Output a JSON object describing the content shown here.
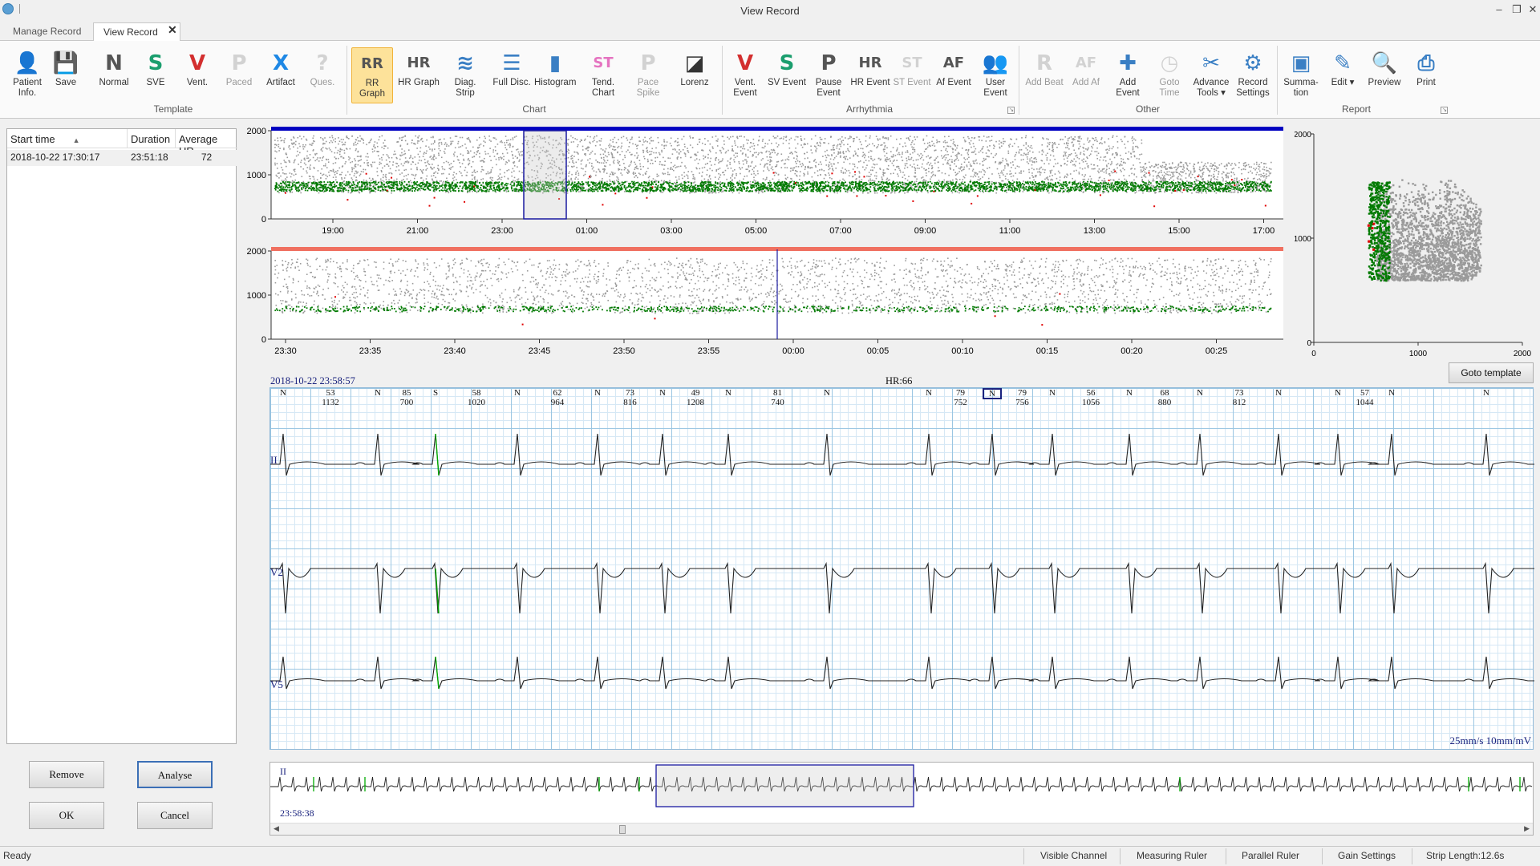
{
  "window": {
    "title": "View Record"
  },
  "tabs": [
    {
      "label": "Manage Record"
    },
    {
      "label": "View Record"
    }
  ],
  "ribbon": {
    "buttons": [
      {
        "label": "Patient Info.",
        "icon": "patient-info-icon",
        "x": 8
      },
      {
        "label": "Save",
        "icon": "save-icon",
        "x": 56
      },
      {
        "label": "Normal",
        "icon": "normal-beat-icon",
        "x": 116
      },
      {
        "label": "SVE",
        "icon": "sve-beat-icon",
        "x": 168
      },
      {
        "label": "Vent.",
        "icon": "vent-beat-icon",
        "x": 220
      },
      {
        "label": "Paced",
        "icon": "paced-beat-icon",
        "x": 272
      },
      {
        "label": "Artifact",
        "icon": "artifact-icon",
        "x": 324
      },
      {
        "label": "Ques.",
        "icon": "questionable-beat-icon",
        "x": 376
      },
      {
        "label": "RR Graph",
        "icon": "rr-graph-icon",
        "x": 438
      },
      {
        "label": "HR Graph",
        "icon": "hr-graph-icon",
        "x": 496
      },
      {
        "label": "Diag. Strip",
        "icon": "diag-strip-icon",
        "x": 554
      },
      {
        "label": "Full Disc.",
        "icon": "full-disclosure-icon",
        "x": 612
      },
      {
        "label": "Histogram",
        "icon": "histogram-icon",
        "x": 666
      },
      {
        "label": "Tend. Chart",
        "icon": "trend-chart-icon",
        "x": 726
      },
      {
        "label": "Pace Spike",
        "icon": "pace-spike-icon",
        "x": 782
      },
      {
        "label": "Lorenz",
        "icon": "lorenz-icon",
        "x": 840
      },
      {
        "label": "Vent. Event",
        "icon": "vent-event-icon",
        "x": 903
      },
      {
        "label": "SV Event",
        "icon": "sv-event-icon",
        "x": 955
      },
      {
        "label": "Pause Event",
        "icon": "pause-event-icon",
        "x": 1007
      },
      {
        "label": "HR Event",
        "icon": "hr-event-icon",
        "x": 1059
      },
      {
        "label": "ST Event",
        "icon": "st-event-icon",
        "x": 1111
      },
      {
        "label": "Af Event",
        "icon": "af-event-icon",
        "x": 1163
      },
      {
        "label": "User Event",
        "icon": "user-event-icon",
        "x": 1215
      },
      {
        "label": "Add Beat",
        "icon": "add-beat-icon",
        "x": 1276
      },
      {
        "label": "Add Af",
        "icon": "add-af-icon",
        "x": 1328
      },
      {
        "label": "Add Event",
        "icon": "add-event-icon",
        "x": 1380
      },
      {
        "label": "Goto Time",
        "icon": "goto-time-icon",
        "x": 1432
      },
      {
        "label": "Advance Tools ▾",
        "icon": "advance-tools-icon",
        "x": 1484
      },
      {
        "label": "Record Settings",
        "icon": "record-settings-icon",
        "x": 1536
      },
      {
        "label": "Summa- tion",
        "icon": "summation-icon",
        "x": 1596
      },
      {
        "label": "Edit ▾",
        "icon": "edit-icon",
        "x": 1648
      },
      {
        "label": "Preview",
        "icon": "preview-icon",
        "x": 1700
      },
      {
        "label": "Print",
        "icon": "print-icon",
        "x": 1752
      }
    ],
    "groups": [
      "Template",
      "Chart",
      "Arrhythmia",
      "Other",
      "Report"
    ]
  },
  "record_list": {
    "headers": [
      "Start time",
      "Duration",
      "Average HR"
    ],
    "rows": [
      [
        "2018-10-22 17:30:17",
        "23:51:18",
        "72"
      ]
    ]
  },
  "buttons": {
    "remove": "Remove",
    "analyse": "Analyse",
    "ok": "OK",
    "cancel": "Cancel",
    "goto_template": "Goto template"
  },
  "chart_data": [
    {
      "type": "scatter",
      "title": "",
      "ylim": [
        0,
        2000
      ],
      "yticks": [
        "2000",
        "1000",
        "0"
      ],
      "xticks": [
        "19:00",
        "21:00",
        "23:00",
        "01:00",
        "03:00",
        "05:00",
        "07:00",
        "09:00",
        "11:00",
        "13:00",
        "15:00",
        "17:00"
      ],
      "series": [
        {
          "color": "#9a9a9a"
        },
        {
          "color": "#007a00"
        },
        {
          "color": "#e00000"
        }
      ]
    },
    {
      "type": "scatter",
      "title": "",
      "ylim": [
        0,
        2000
      ],
      "yticks": [
        "2000",
        "1000",
        "0"
      ],
      "xticks": [
        "23:30",
        "23:35",
        "23:40",
        "23:45",
        "23:50",
        "23:55",
        "00:00",
        "00:05",
        "00:10",
        "00:15",
        "00:20",
        "00:25"
      ],
      "series": [
        {
          "color": "#9a9a9a"
        },
        {
          "color": "#007a00"
        },
        {
          "color": "#e00000"
        }
      ]
    },
    {
      "type": "scatter",
      "title": "",
      "xlim": [
        0,
        2000
      ],
      "ylim": [
        0,
        2000
      ],
      "yticks": [
        "2000",
        "1000",
        "0"
      ],
      "xticks": [
        "0",
        "1000",
        "2000"
      ],
      "series": [
        {
          "color": "#9a9a9a"
        },
        {
          "color": "#007a00"
        },
        {
          "color": "#e00000"
        }
      ]
    }
  ],
  "ecg": {
    "timestamp": "2018-10-22 23:58:57",
    "hr": "HR:66",
    "leads": [
      "II",
      "V2",
      "V5"
    ],
    "scale": "25mm/s 10mm/mV",
    "beats": [
      {
        "t": "N",
        "c": "#222"
      },
      {
        "t": "N",
        "c": "#222"
      },
      {
        "t": "S",
        "c": "#0a0"
      },
      {
        "t": "N",
        "c": "#222"
      },
      {
        "t": "N",
        "c": "#222"
      },
      {
        "t": "N",
        "c": "#222"
      },
      {
        "t": "N",
        "c": "#222"
      },
      {
        "t": "N",
        "c": "#222"
      },
      {
        "t": "N",
        "c": "#222"
      },
      {
        "t": "N",
        "c": "#222"
      },
      {
        "t": "N",
        "c": "#222"
      },
      {
        "t": "N",
        "c": "#222"
      },
      {
        "t": "N",
        "c": "#222"
      },
      {
        "t": "N",
        "c": "#222"
      },
      {
        "t": "N",
        "c": "#222"
      },
      {
        "t": "N",
        "c": "#222"
      },
      {
        "t": "N",
        "c": "#222"
      }
    ],
    "intervals": [
      {
        "hr": "53",
        "rr": "1132"
      },
      {
        "hr": "85",
        "rr": "700"
      },
      {
        "hr": "58",
        "rr": "1020"
      },
      {
        "hr": "62",
        "rr": "964"
      },
      {
        "hr": "73",
        "rr": "816"
      },
      {
        "hr": "49",
        "rr": "1208"
      },
      {
        "hr": "81",
        "rr": "740"
      },
      {
        "hr": "79",
        "rr": "752"
      },
      {
        "hr": "79",
        "rr": "756"
      },
      {
        "hr": "56",
        "rr": "1056"
      },
      {
        "hr": "68",
        "rr": "880"
      },
      {
        "hr": "73",
        "rr": "812"
      },
      {
        "hr": "57",
        "rr": "1044"
      }
    ]
  },
  "overview_strip": {
    "lead": "II",
    "time": "23:58:38"
  },
  "statusbar": {
    "ready": "Ready",
    "items": [
      "Visible Channel",
      "Measuring Ruler",
      "Parallel Ruler",
      "Gain Settings",
      "Strip Length:12.6s"
    ]
  }
}
